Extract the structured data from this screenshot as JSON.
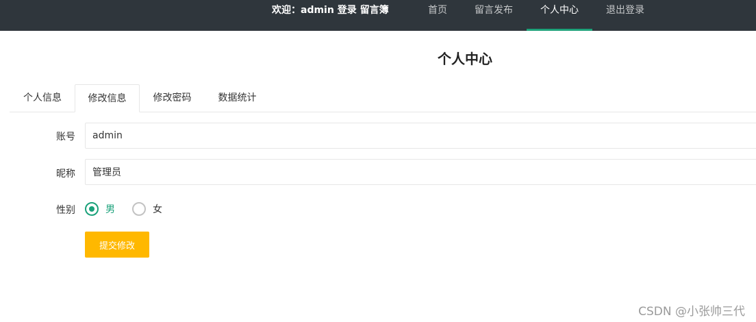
{
  "header": {
    "welcome": "欢迎：admin 登录 留言簿",
    "nav": [
      {
        "label": "首页",
        "active": false
      },
      {
        "label": "留言发布",
        "active": false
      },
      {
        "label": "个人中心",
        "active": true
      },
      {
        "label": "退出登录",
        "active": false
      }
    ]
  },
  "page": {
    "title": "个人中心"
  },
  "tabs": [
    {
      "label": "个人信息",
      "active": false
    },
    {
      "label": "修改信息",
      "active": true
    },
    {
      "label": "修改密码",
      "active": false
    },
    {
      "label": "数据统计",
      "active": false
    }
  ],
  "form": {
    "account": {
      "label": "账号",
      "value": "admin"
    },
    "nickname": {
      "label": "昵称",
      "value": "管理员"
    },
    "gender": {
      "label": "性别",
      "options": [
        {
          "label": "男",
          "checked": true
        },
        {
          "label": "女",
          "checked": false
        }
      ]
    },
    "submit_label": "提交修改"
  },
  "watermark": "CSDN @小张帅三代",
  "colors": {
    "topbar": "#2f363c",
    "accent_green": "#1aa17a",
    "button_yellow": "#ffb800"
  }
}
